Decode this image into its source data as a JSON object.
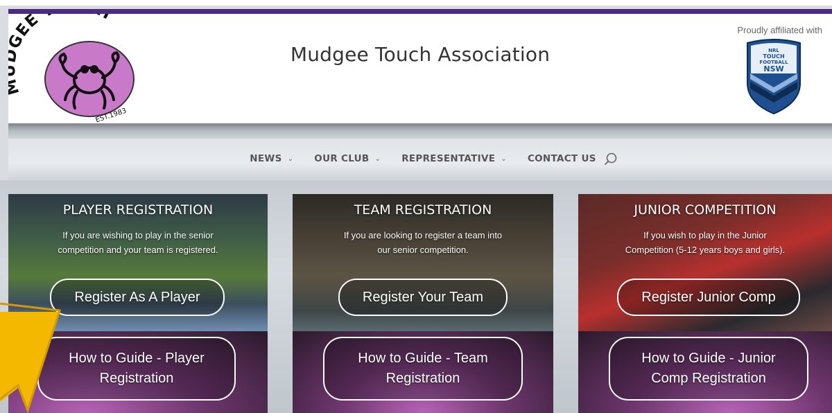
{
  "header": {
    "logo_text": "MUDGEE TOUCH",
    "logo_est": "EST.1983",
    "title": "Mudgee Touch Association",
    "affiliation": "Proudly affiliated with",
    "badge_text": [
      "NRL",
      "TOUCH",
      "FOOTBALL",
      "NSW"
    ]
  },
  "nav": {
    "items": [
      {
        "label": "NEWS",
        "icon": "chevron-down-icon"
      },
      {
        "label": "OUR CLUB",
        "icon": "chevron-down-icon"
      },
      {
        "label": "REPRESENTATIVE",
        "icon": "chevron-down-icon"
      },
      {
        "label": "CONTACT US",
        "icon": ""
      }
    ],
    "search_icon": "search-icon"
  },
  "cards": [
    {
      "title": "PLAYER REGISTRATION",
      "description_lines": [
        "If you are wishing to play in the senior",
        "competition and your team is registered."
      ],
      "primary_button": "Register As A Player",
      "guide_button_lines": [
        "How to Guide - Player",
        "Registration"
      ]
    },
    {
      "title": "TEAM REGISTRATION",
      "description_lines": [
        "If you are looking to register a team into",
        "our senior competition."
      ],
      "primary_button": "Register Your Team",
      "guide_button_lines": [
        "How to Guide - Team",
        "Registration"
      ]
    },
    {
      "title": "JUNIOR COMPETITION",
      "description_lines": [
        "If you wish to play in the Junior",
        "Competition (5-12 years boys and girls)."
      ],
      "primary_button": "Register Junior Comp",
      "guide_button_lines": [
        "How to Guide - Junior",
        "Comp Registration"
      ]
    }
  ],
  "colors": {
    "accent_purple": "#4a2b7e",
    "logo_pink": "#c879c8",
    "badge_blue": "#1f4f8f",
    "arrow_yellow": "#f5b800"
  }
}
